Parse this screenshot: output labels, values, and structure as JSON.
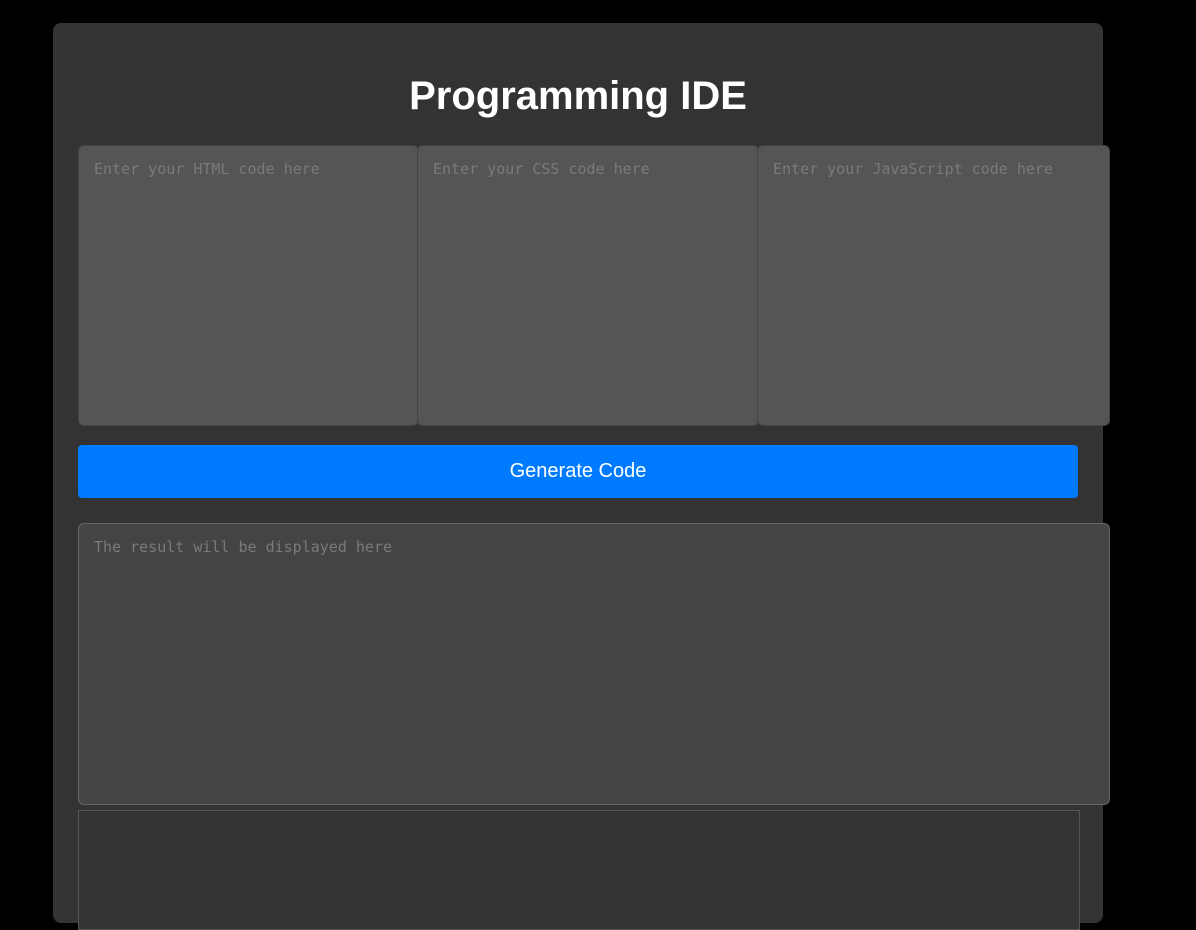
{
  "title": "Programming IDE",
  "editors": {
    "html_placeholder": "Enter your HTML code here",
    "css_placeholder": "Enter your CSS code here",
    "js_placeholder": "Enter your JavaScript code here"
  },
  "generate_label": "Generate Code",
  "result_placeholder": "The result will be displayed here",
  "colors": {
    "accent": "#007bff",
    "panel": "#333333",
    "editor": "#555555"
  }
}
